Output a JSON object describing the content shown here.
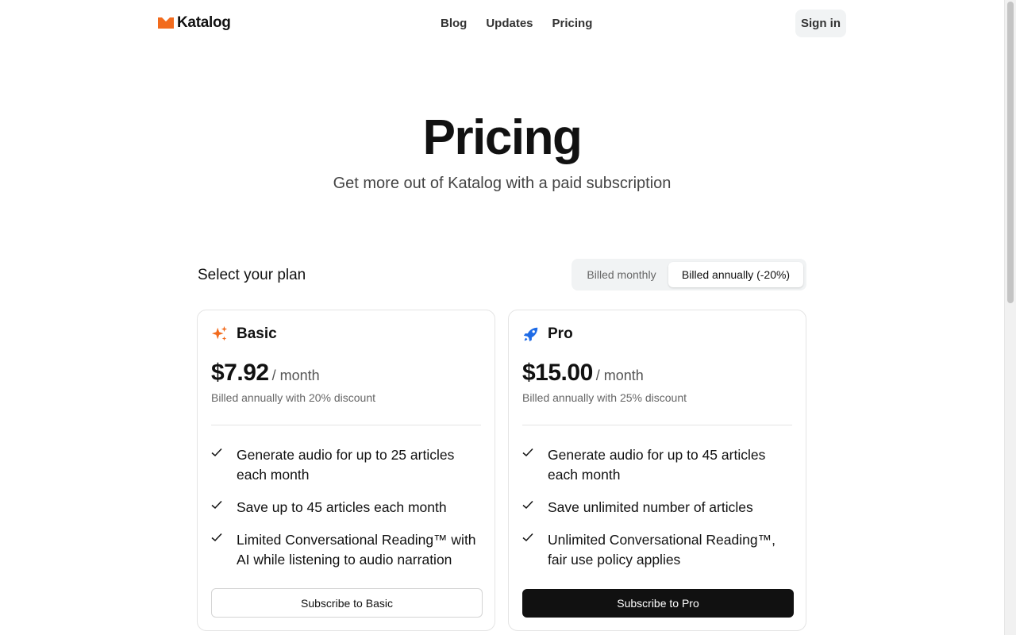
{
  "brand": {
    "name": "Katalog",
    "color": "#f26b1d"
  },
  "nav": {
    "items": [
      "Blog",
      "Updates",
      "Pricing"
    ]
  },
  "header": {
    "signin_label": "Sign in"
  },
  "hero": {
    "title": "Pricing",
    "subtitle": "Get more out of Katalog with a paid subscription"
  },
  "plan_select": {
    "label": "Select your plan",
    "billing_options": [
      "Billed monthly",
      "Billed annually (-20%)"
    ],
    "selected": "Billed annually (-20%)"
  },
  "plans": [
    {
      "name": "Basic",
      "icon": "sparkles-icon",
      "icon_color": "#f26b1d",
      "price": "$7.92",
      "period": "/ month",
      "billing_note": "Billed annually with 20% discount",
      "features": [
        "Generate audio for up to 25 articles each month",
        "Save up to 45 articles each month",
        "Limited Conversational Reading™ with AI while listening to audio narration"
      ],
      "cta": "Subscribe to Basic"
    },
    {
      "name": "Pro",
      "icon": "rocket-icon",
      "icon_color": "#1e6be6",
      "price": "$15.00",
      "period": "/ month",
      "billing_note": "Billed annually with 25% discount",
      "features": [
        "Generate audio for up to 45 articles each month",
        "Save unlimited number of articles",
        "Unlimited Conversational Reading™, fair use policy applies"
      ],
      "cta": "Subscribe to Pro"
    }
  ]
}
